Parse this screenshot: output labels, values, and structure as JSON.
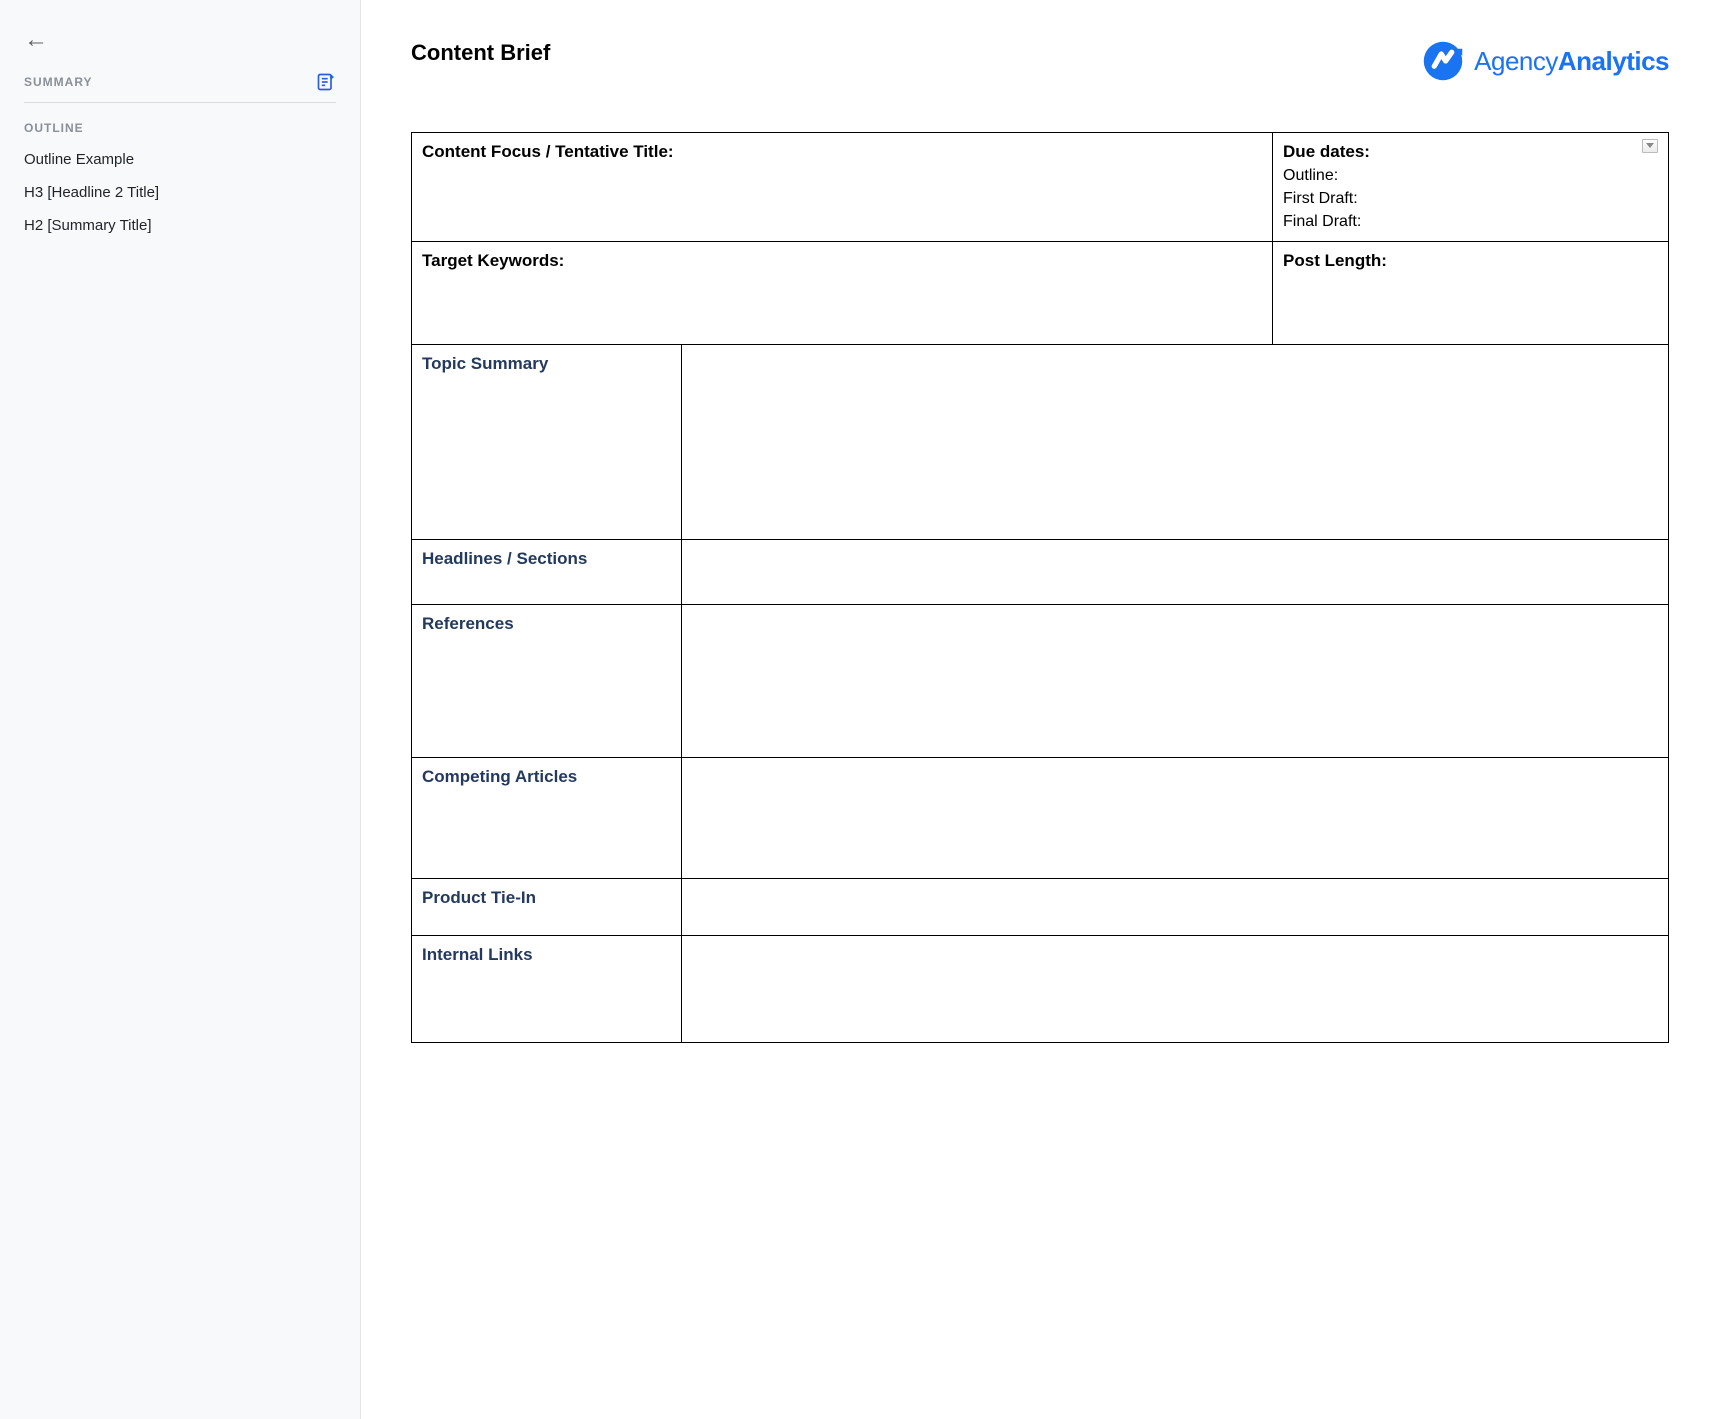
{
  "sidebar": {
    "summary_label": "SUMMARY",
    "outline_label": "OUTLINE",
    "items": [
      {
        "label": "Outline Example"
      },
      {
        "label": "H3 [Headline 2 Title]"
      },
      {
        "label": "H2 [Summary Title]"
      }
    ]
  },
  "doc": {
    "title": "Content Brief",
    "brand_light": "Agency",
    "brand_bold": "Analytics"
  },
  "brief": {
    "content_focus_label": "Content Focus / Tentative Title:",
    "due_dates_label": "Due dates:",
    "due_outline": "Outline:",
    "due_first_draft": "First Draft:",
    "due_final_draft": "Final Draft:",
    "target_keywords_label": "Target Keywords:",
    "post_length_label": "Post Length:",
    "topic_summary_label": "Topic Summary",
    "headlines_sections_label": "Headlines / Sections",
    "references_label": "References",
    "competing_articles_label": "Competing Articles",
    "product_tie_in_label": "Product Tie-In",
    "internal_links_label": "Internal Links"
  }
}
